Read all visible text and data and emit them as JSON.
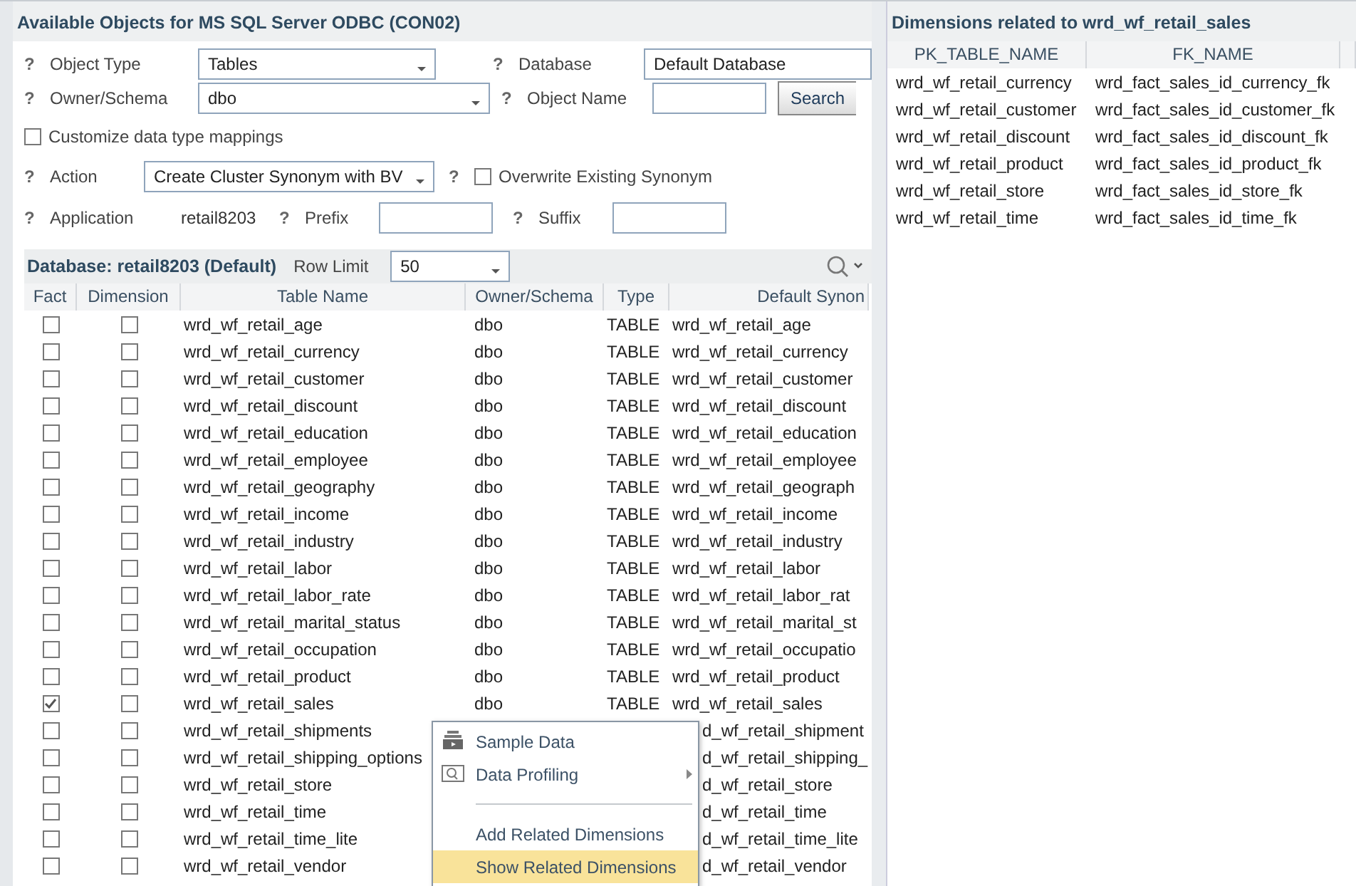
{
  "left_panel": {
    "title": "Available Objects for MS SQL Server ODBC (CON02)",
    "help_mark": "?",
    "object_type": {
      "label": "Object Type",
      "value": "Tables"
    },
    "database": {
      "label": "Database",
      "value": "Default Database"
    },
    "owner_schema": {
      "label": "Owner/Schema",
      "value": "dbo"
    },
    "object_name": {
      "label": "Object Name"
    },
    "search_button": "Search",
    "customize": {
      "label": "Customize data type mappings",
      "checked": false
    },
    "action": {
      "label": "Action",
      "value": "Create Cluster Synonym with BV"
    },
    "overwrite": {
      "label": "Overwrite Existing Synonym",
      "checked": false
    },
    "application": {
      "label": "Application",
      "value": "retail8203"
    },
    "prefix": {
      "label": "Prefix"
    },
    "suffix": {
      "label": "Suffix"
    },
    "grid_bar": {
      "title": "Database: retail8203 (Default)",
      "row_limit_label": "Row Limit",
      "row_limit": "50"
    },
    "table": {
      "columns": [
        "Fact",
        "Dimension",
        "Table Name",
        "Owner/Schema",
        "Type",
        "Default Synon"
      ],
      "rows": [
        {
          "fact": false,
          "dimension": false,
          "name": "wrd_wf_retail_age",
          "owner": "dbo",
          "type": "TABLE",
          "synonym": "wrd_wf_retail_age"
        },
        {
          "fact": false,
          "dimension": false,
          "name": "wrd_wf_retail_currency",
          "owner": "dbo",
          "type": "TABLE",
          "synonym": "wrd_wf_retail_currency"
        },
        {
          "fact": false,
          "dimension": false,
          "name": "wrd_wf_retail_customer",
          "owner": "dbo",
          "type": "TABLE",
          "synonym": "wrd_wf_retail_customer"
        },
        {
          "fact": false,
          "dimension": false,
          "name": "wrd_wf_retail_discount",
          "owner": "dbo",
          "type": "TABLE",
          "synonym": "wrd_wf_retail_discount"
        },
        {
          "fact": false,
          "dimension": false,
          "name": "wrd_wf_retail_education",
          "owner": "dbo",
          "type": "TABLE",
          "synonym": "wrd_wf_retail_education"
        },
        {
          "fact": false,
          "dimension": false,
          "name": "wrd_wf_retail_employee",
          "owner": "dbo",
          "type": "TABLE",
          "synonym": "wrd_wf_retail_employee"
        },
        {
          "fact": false,
          "dimension": false,
          "name": "wrd_wf_retail_geography",
          "owner": "dbo",
          "type": "TABLE",
          "synonym": "wrd_wf_retail_geograph"
        },
        {
          "fact": false,
          "dimension": false,
          "name": "wrd_wf_retail_income",
          "owner": "dbo",
          "type": "TABLE",
          "synonym": "wrd_wf_retail_income"
        },
        {
          "fact": false,
          "dimension": false,
          "name": "wrd_wf_retail_industry",
          "owner": "dbo",
          "type": "TABLE",
          "synonym": "wrd_wf_retail_industry"
        },
        {
          "fact": false,
          "dimension": false,
          "name": "wrd_wf_retail_labor",
          "owner": "dbo",
          "type": "TABLE",
          "synonym": "wrd_wf_retail_labor"
        },
        {
          "fact": false,
          "dimension": false,
          "name": "wrd_wf_retail_labor_rate",
          "owner": "dbo",
          "type": "TABLE",
          "synonym": "wrd_wf_retail_labor_rat"
        },
        {
          "fact": false,
          "dimension": false,
          "name": "wrd_wf_retail_marital_status",
          "owner": "dbo",
          "type": "TABLE",
          "synonym": "wrd_wf_retail_marital_st"
        },
        {
          "fact": false,
          "dimension": false,
          "name": "wrd_wf_retail_occupation",
          "owner": "dbo",
          "type": "TABLE",
          "synonym": "wrd_wf_retail_occupatio"
        },
        {
          "fact": false,
          "dimension": false,
          "name": "wrd_wf_retail_product",
          "owner": "dbo",
          "type": "TABLE",
          "synonym": "wrd_wf_retail_product"
        },
        {
          "fact": true,
          "dimension": false,
          "name": "wrd_wf_retail_sales",
          "owner": "dbo",
          "type": "TABLE",
          "synonym": "wrd_wf_retail_sales"
        },
        {
          "fact": false,
          "dimension": false,
          "name": "wrd_wf_retail_shipments",
          "synonym": "d_wf_retail_shipment"
        },
        {
          "fact": false,
          "dimension": false,
          "name": "wrd_wf_retail_shipping_options",
          "synonym": "d_wf_retail_shipping_"
        },
        {
          "fact": false,
          "dimension": false,
          "name": "wrd_wf_retail_store",
          "synonym": "d_wf_retail_store"
        },
        {
          "fact": false,
          "dimension": false,
          "name": "wrd_wf_retail_time",
          "synonym": "d_wf_retail_time"
        },
        {
          "fact": false,
          "dimension": false,
          "name": "wrd_wf_retail_time_lite",
          "synonym": "d_wf_retail_time_lite"
        },
        {
          "fact": false,
          "dimension": false,
          "name": "wrd_wf_retail_vendor",
          "synonym": "d_wf_retail_vendor"
        }
      ]
    },
    "context_menu": {
      "items": [
        {
          "kind": "icon",
          "label": "Sample Data",
          "submenu": false,
          "selected": false
        },
        {
          "kind": "icon",
          "label": "Data Profiling",
          "submenu": true,
          "selected": false
        },
        {
          "kind": "separator"
        },
        {
          "kind": "plain",
          "label": "Add Related Dimensions",
          "submenu": false,
          "selected": false
        },
        {
          "kind": "plain",
          "label": "Show Related Dimensions",
          "submenu": false,
          "selected": true
        }
      ]
    }
  },
  "right_panel": {
    "title": "Dimensions related to wrd_wf_retail_sales",
    "columns": [
      "PK_TABLE_NAME",
      "FK_NAME"
    ],
    "rows": [
      [
        "wrd_wf_retail_currency",
        "wrd_fact_sales_id_currency_fk"
      ],
      [
        "wrd_wf_retail_customer",
        "wrd_fact_sales_id_customer_fk"
      ],
      [
        "wrd_wf_retail_discount",
        "wrd_fact_sales_id_discount_fk"
      ],
      [
        "wrd_wf_retail_product",
        "wrd_fact_sales_id_product_fk"
      ],
      [
        "wrd_wf_retail_store",
        "wrd_fact_sales_id_store_fk"
      ],
      [
        "wrd_wf_retail_time",
        "wrd_fact_sales_id_time_fk"
      ]
    ]
  }
}
